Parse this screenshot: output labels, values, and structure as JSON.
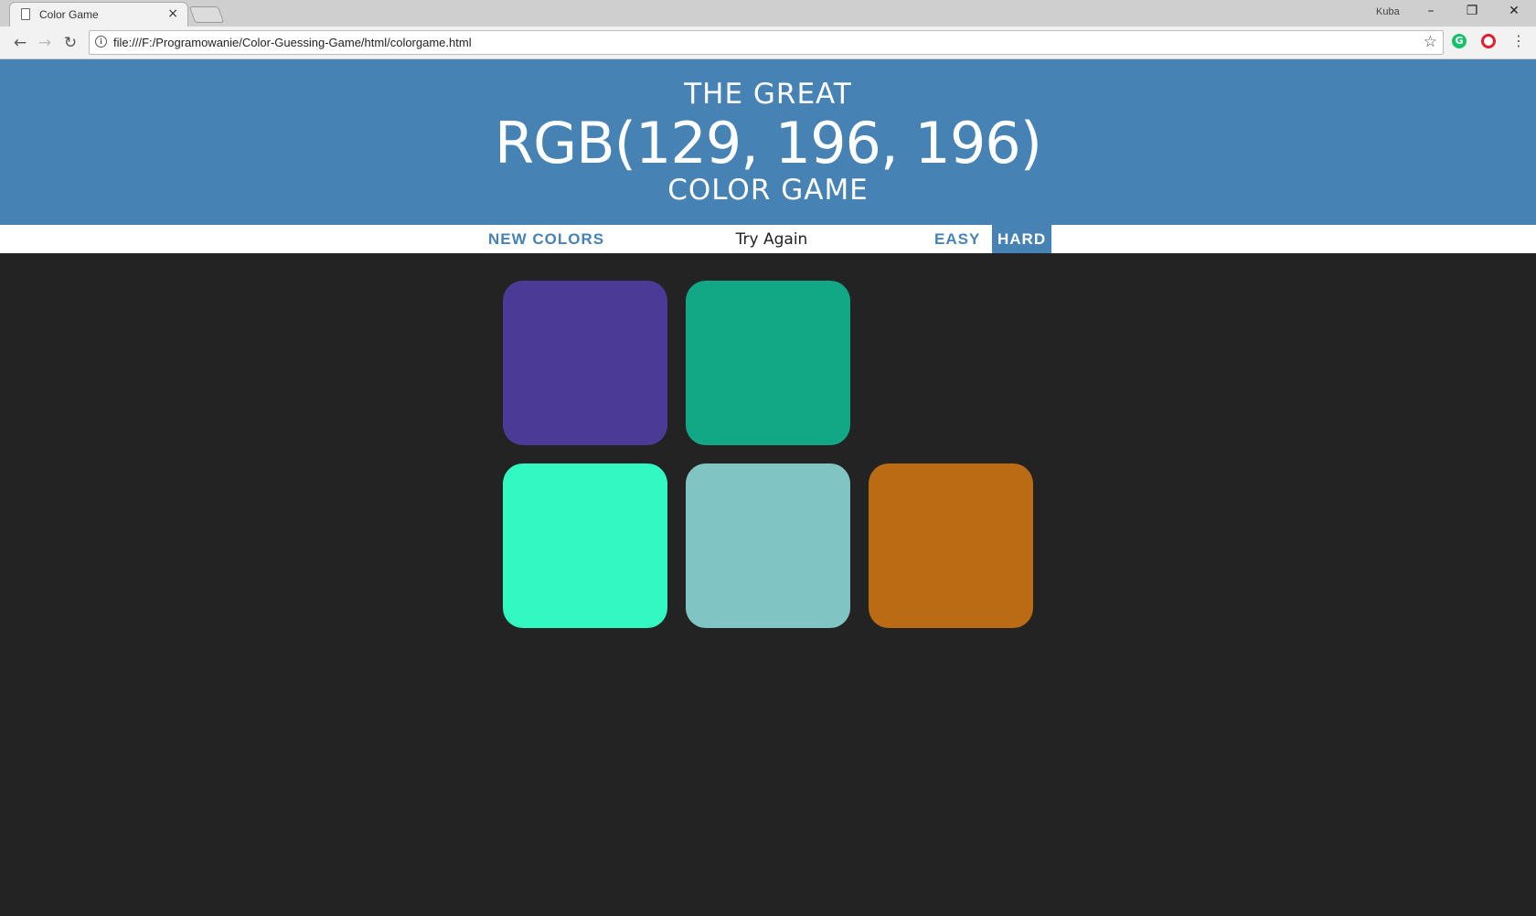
{
  "browser": {
    "tab_title": "Color Game",
    "tab_close": "×",
    "profile_name": "Kuba",
    "window_controls": {
      "minimize": "–",
      "restore": "❐",
      "close": "✕"
    },
    "nav": {
      "back": "←",
      "forward": "→",
      "reload": "↻"
    },
    "url": "file:///F:/Programowanie/Color-Guessing-Game/html/colorgame.html",
    "bookmark_icon": "star-icon",
    "menu": "⋮"
  },
  "game": {
    "header": {
      "line1": "THE GREAT",
      "target_color": "RGB(129, 196, 196)",
      "line3": "COLOR GAME"
    },
    "controls": {
      "new_colors": "NEW COLORS",
      "message": "Try Again",
      "easy": "EASY",
      "hard": "HARD",
      "selected_mode": "HARD"
    },
    "colors": {
      "header_bg": "#4682b4",
      "page_bg": "#232323"
    },
    "squares": [
      {
        "color": "#4b3a96",
        "visible": true
      },
      {
        "color": "#13a885",
        "visible": true
      },
      {
        "color": "#232323",
        "visible": false
      },
      {
        "color": "#32f8c2",
        "visible": true
      },
      {
        "color": "#81c4c4",
        "visible": true
      },
      {
        "color": "#bb6b13",
        "visible": true
      }
    ]
  }
}
